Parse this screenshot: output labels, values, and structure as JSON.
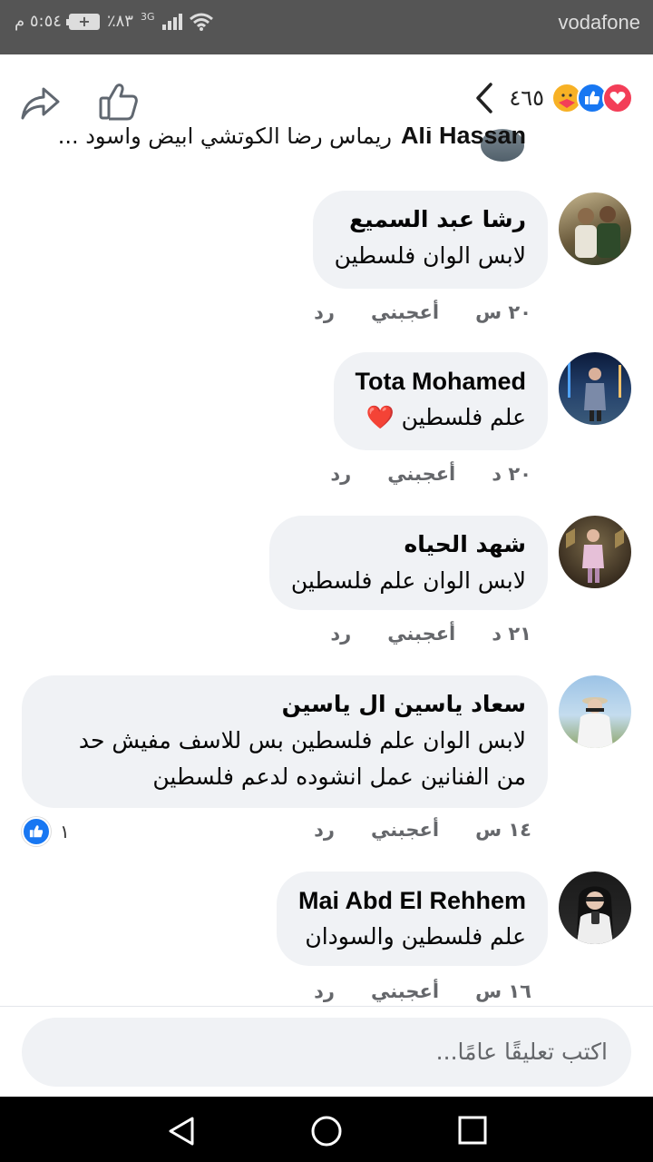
{
  "status_bar": {
    "carrier": "vodafone",
    "time": "٥:٥٤ م",
    "battery": "٪٨٣",
    "network": "3G"
  },
  "header": {
    "reaction_count": "٤٦٥",
    "reaction_types": [
      "care",
      "like",
      "love"
    ]
  },
  "peek_comment": {
    "name": "Ali Hassan",
    "text": "ريماس رضا الكوتشي ابيض واسود ..."
  },
  "comments": [
    {
      "name": "رشا عبد السميع",
      "text": [
        "لابس الوان فلسطين"
      ],
      "time": "٢٠ س",
      "like_label": "أعجبني",
      "reply_label": "رد",
      "reactions": null
    },
    {
      "name": "Tota Mohamed",
      "text": [
        "علم فلسطين ❤️"
      ],
      "time": "٢٠ د",
      "like_label": "أعجبني",
      "reply_label": "رد",
      "reactions": null
    },
    {
      "name": "شهد الحياه",
      "text": [
        "لابس الوان علم فلسطين"
      ],
      "time": "٢١ د",
      "like_label": "أعجبني",
      "reply_label": "رد",
      "reactions": null
    },
    {
      "name": "سعاد ياسين ال ياسين",
      "text": [
        "لابس الوان علم فلسطين بس للاسف مفيش حد",
        "من الفنانين عمل انشوده لدعم فلسطين"
      ],
      "time": "١٤ س",
      "like_label": "أعجبني",
      "reply_label": "رد",
      "reactions": "١"
    },
    {
      "name": "Mai Abd El Rehhem",
      "text": [
        "علم فلسطين والسودان"
      ],
      "time": "١٦ س",
      "like_label": "أعجبني",
      "reply_label": "رد",
      "reactions": null
    }
  ],
  "composer": {
    "placeholder": "اكتب تعليقًا عامًا..."
  },
  "colors": {
    "accent": "#1877f2",
    "bubble": "#f0f2f5",
    "meta": "#65676b"
  }
}
